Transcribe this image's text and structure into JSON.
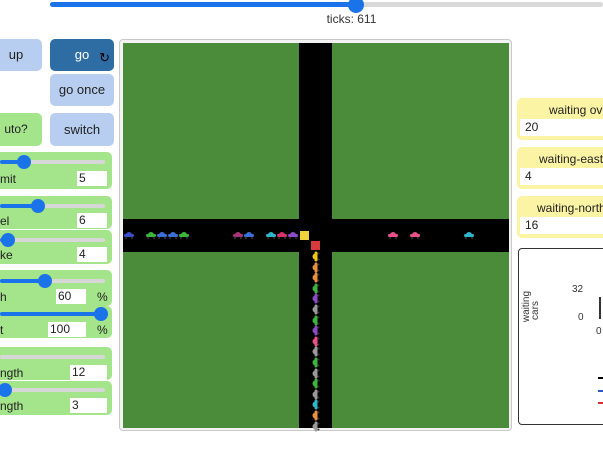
{
  "speed": {
    "value": 0.55
  },
  "ticks_text": "ticks: 611",
  "buttons": {
    "setup": "up",
    "go": "go",
    "go_once": "go once",
    "switch": "switch",
    "auto": "uto?"
  },
  "sliders": [
    {
      "label": "mit",
      "value": "5",
      "unit": "",
      "level": 0.22
    },
    {
      "label": "el",
      "value": "6",
      "unit": "",
      "level": 0.34
    },
    {
      "label": "ke",
      "value": "4",
      "unit": "",
      "level": 0.06
    },
    {
      "label": "h",
      "value": "60",
      "unit": "%",
      "level": 0.42
    },
    {
      "label": "t",
      "value": "100",
      "unit": "%",
      "level": 1.0
    },
    {
      "label": "ngth",
      "value": "12",
      "unit": "",
      "level": 0.0
    },
    {
      "label": "ngth",
      "value": "3",
      "unit": "",
      "level": 0.04
    }
  ],
  "monitors": [
    {
      "label": "waiting ove",
      "value": "20"
    },
    {
      "label": "waiting-eastb",
      "value": "4"
    },
    {
      "label": "waiting-northl",
      "value": "16"
    }
  ],
  "plot": {
    "ylabel_line1": "waiting",
    "ylabel_line2": "cars",
    "y_max": "32",
    "y_min": "0",
    "x_min": "0"
  },
  "cars": {
    "eastbound_colors": [
      "#3a4fc9",
      "#3bb53b",
      "#3b6fd6",
      "#3b6fd6",
      "#3bb53b",
      "#a8327a",
      "#3b6fd6",
      "#2fb5c9",
      "#d6336b",
      "#8c49c9",
      "#e94f8a",
      "#e94f8a",
      "#2fb5c9"
    ],
    "northbound_colors": [
      "#f0c419",
      "#e8903c",
      "#e8903c",
      "#3bb53b",
      "#8c49c9",
      "#9a9a9a",
      "#3bb53b",
      "#8c49c9",
      "#e94f8a",
      "#9a9a9a",
      "#3bb53b",
      "#9a9a9a",
      "#3bb53b",
      "#9a9a9a",
      "#2fb5c9",
      "#e8903c",
      "#9a9a9a"
    ]
  },
  "signals": {
    "east_light": "#f0d23c",
    "north_light": "#d63a3a"
  }
}
